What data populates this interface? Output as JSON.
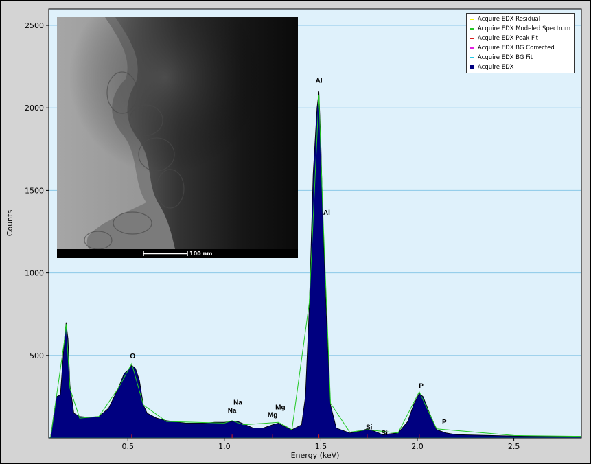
{
  "chart_data": {
    "type": "bar",
    "title": "",
    "xlabel": "Energy (keV)",
    "ylabel": "Counts",
    "xlim": [
      0.09,
      2.85
    ],
    "ylim": [
      0,
      2600
    ],
    "x_ticks": [
      "0.5",
      "1.0",
      "1.5",
      "2.0",
      "2.5"
    ],
    "y_ticks": [
      "500",
      "1000",
      "1500",
      "2000",
      "2500"
    ],
    "grid": "horizontal",
    "legend_position": "top-right",
    "legend": [
      {
        "label": "Acquire EDX Residual",
        "color": "#f5f500"
      },
      {
        "label": "Acquire EDX Modeled Spectrum",
        "color": "#22c822"
      },
      {
        "label": "Acquire EDX Peak Fit",
        "color": "#d81b1b"
      },
      {
        "label": "Acquire EDX BG Corrected",
        "color": "#e020e0"
      },
      {
        "label": "Acquire EDX BG Fit",
        "color": "#22c8e8"
      },
      {
        "label": "Acquire EDX",
        "color": "#000080"
      }
    ],
    "series": [
      {
        "name": "Acquire EDX",
        "color": "#000080",
        "points": [
          [
            0.1,
            10
          ],
          [
            0.13,
            250
          ],
          [
            0.15,
            260
          ],
          [
            0.17,
            580
          ],
          [
            0.18,
            700
          ],
          [
            0.19,
            600
          ],
          [
            0.2,
            320
          ],
          [
            0.22,
            150
          ],
          [
            0.25,
            130
          ],
          [
            0.3,
            125
          ],
          [
            0.35,
            130
          ],
          [
            0.4,
            180
          ],
          [
            0.45,
            300
          ],
          [
            0.48,
            390
          ],
          [
            0.5,
            410
          ],
          [
            0.52,
            440
          ],
          [
            0.54,
            420
          ],
          [
            0.56,
            350
          ],
          [
            0.58,
            200
          ],
          [
            0.6,
            150
          ],
          [
            0.65,
            120
          ],
          [
            0.7,
            105
          ],
          [
            0.8,
            90
          ],
          [
            0.9,
            90
          ],
          [
            0.95,
            95
          ],
          [
            1.0,
            95
          ],
          [
            1.04,
            100
          ],
          [
            1.07,
            100
          ],
          [
            1.1,
            85
          ],
          [
            1.15,
            60
          ],
          [
            1.2,
            60
          ],
          [
            1.25,
            80
          ],
          [
            1.28,
            90
          ],
          [
            1.31,
            70
          ],
          [
            1.35,
            50
          ],
          [
            1.4,
            80
          ],
          [
            1.42,
            250
          ],
          [
            1.44,
            800
          ],
          [
            1.46,
            1600
          ],
          [
            1.48,
            2000
          ],
          [
            1.49,
            2100
          ],
          [
            1.5,
            1800
          ],
          [
            1.51,
            1340
          ],
          [
            1.53,
            700
          ],
          [
            1.55,
            200
          ],
          [
            1.58,
            60
          ],
          [
            1.65,
            30
          ],
          [
            1.7,
            40
          ],
          [
            1.74,
            55
          ],
          [
            1.78,
            40
          ],
          [
            1.82,
            20
          ],
          [
            1.9,
            30
          ],
          [
            1.95,
            100
          ],
          [
            1.98,
            200
          ],
          [
            2.01,
            270
          ],
          [
            2.03,
            250
          ],
          [
            2.06,
            160
          ],
          [
            2.1,
            50
          ],
          [
            2.15,
            30
          ],
          [
            2.2,
            20
          ],
          [
            2.5,
            12
          ],
          [
            2.85,
            10
          ]
        ]
      },
      {
        "name": "Acquire EDX Modeled Spectrum",
        "color": "#22c822",
        "points": [
          [
            0.1,
            5
          ],
          [
            0.17,
            580
          ],
          [
            0.18,
            690
          ],
          [
            0.2,
            300
          ],
          [
            0.25,
            120
          ],
          [
            0.35,
            130
          ],
          [
            0.45,
            300
          ],
          [
            0.52,
            450
          ],
          [
            0.58,
            200
          ],
          [
            0.7,
            100
          ],
          [
            1.0,
            90
          ],
          [
            1.04,
            105
          ],
          [
            1.1,
            80
          ],
          [
            1.28,
            95
          ],
          [
            1.35,
            50
          ],
          [
            1.44,
            820
          ],
          [
            1.49,
            2080
          ],
          [
            1.51,
            1380
          ],
          [
            1.55,
            210
          ],
          [
            1.65,
            35
          ],
          [
            1.74,
            50
          ],
          [
            1.9,
            30
          ],
          [
            2.01,
            280
          ],
          [
            2.1,
            55
          ],
          [
            2.5,
            15
          ],
          [
            2.85,
            10
          ]
        ]
      }
    ],
    "peak_fit_lines": [
      0.52,
      1.04,
      1.25,
      1.49,
      1.74,
      2.01
    ],
    "annotations": [
      {
        "text": "O",
        "x": 0.525,
        "y": 470
      },
      {
        "text": "Na",
        "x": 1.07,
        "y": 190
      },
      {
        "text": "Na",
        "x": 1.04,
        "y": 140
      },
      {
        "text": "Mg",
        "x": 1.29,
        "y": 160
      },
      {
        "text": "Mg",
        "x": 1.25,
        "y": 115
      },
      {
        "text": "Al",
        "x": 1.49,
        "y": 2140
      },
      {
        "text": "Al",
        "x": 1.53,
        "y": 1340
      },
      {
        "text": "Si",
        "x": 1.75,
        "y": 40
      },
      {
        "text": "Si",
        "x": 1.83,
        "y": 5
      },
      {
        "text": "P",
        "x": 2.02,
        "y": 290
      },
      {
        "text": "P",
        "x": 2.14,
        "y": 70
      }
    ]
  },
  "inset": {
    "scale_label": "100 nm"
  }
}
